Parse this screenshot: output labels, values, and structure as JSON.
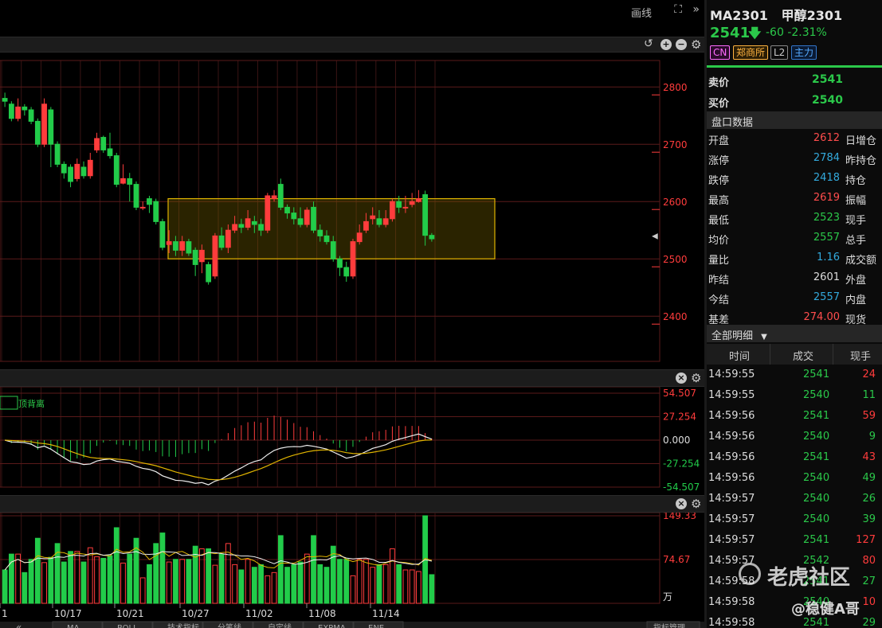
{
  "toolbar": {
    "draw_label": "画线"
  },
  "instrument": {
    "code": "MA2301",
    "name": "甲醇2301",
    "price": "2541",
    "change": "-60",
    "change_pct": "-2.31%",
    "tags": [
      "CN",
      "郑商所",
      "L2",
      "主力"
    ]
  },
  "quote": {
    "ask_label": "卖价",
    "ask": "2541",
    "bid_label": "买价",
    "bid": "2540",
    "section_label": "盘口数据",
    "rows": [
      {
        "k": "开盘",
        "v": "2612",
        "k2": "日增仓",
        "color": "#ff4d4d"
      },
      {
        "k": "涨停",
        "v": "2784",
        "k2": "昨持仓",
        "color": "#33aadd"
      },
      {
        "k": "跌停",
        "v": "2418",
        "k2": "持仓",
        "color": "#33aadd"
      },
      {
        "k": "最高",
        "v": "2619",
        "k2": "振幅",
        "color": "#ff4d4d"
      },
      {
        "k": "最低",
        "v": "2523",
        "k2": "现手",
        "color": "#2bc84a"
      },
      {
        "k": "均价",
        "v": "2557",
        "k2": "总手",
        "color": "#2bc84a"
      },
      {
        "k": "量比",
        "v": "1.16",
        "k2": "成交额",
        "color": "#33aadd"
      },
      {
        "k": "昨结",
        "v": "2601",
        "k2": "外盘",
        "color": "#dddddd"
      },
      {
        "k": "今结",
        "v": "2557",
        "k2": "内盘",
        "color": "#33aadd"
      },
      {
        "k": "基差",
        "v": "274.00",
        "k2": "现货",
        "color": "#ff4d4d"
      }
    ]
  },
  "trades": {
    "section_label": "全部明细",
    "headers": [
      "时间",
      "成交",
      "现手"
    ],
    "rows": [
      {
        "time": "14:59:55",
        "price": "2541",
        "qty": "24",
        "up": true
      },
      {
        "time": "14:59:55",
        "price": "2540",
        "qty": "11",
        "up": false
      },
      {
        "time": "14:59:56",
        "price": "2541",
        "qty": "59",
        "up": true
      },
      {
        "time": "14:59:56",
        "price": "2540",
        "qty": "9",
        "up": false
      },
      {
        "time": "14:59:56",
        "price": "2541",
        "qty": "43",
        "up": true
      },
      {
        "time": "14:59:56",
        "price": "2540",
        "qty": "49",
        "up": false
      },
      {
        "time": "14:59:57",
        "price": "2540",
        "qty": "26",
        "up": false
      },
      {
        "time": "14:59:57",
        "price": "2540",
        "qty": "39",
        "up": false
      },
      {
        "time": "14:59:57",
        "price": "2541",
        "qty": "127",
        "up": true
      },
      {
        "time": "14:59:57",
        "price": "2542",
        "qty": "80",
        "up": true
      },
      {
        "time": "14:59:58",
        "price": "2541",
        "qty": "27",
        "up": false
      },
      {
        "time": "14:59:58",
        "price": "2540",
        "qty": "10",
        "up": true
      },
      {
        "time": "14:59:58",
        "price": "2541",
        "qty": "29",
        "up": false
      }
    ]
  },
  "watermark": {
    "brand": "老虎社区",
    "author": "@稳健A哥"
  },
  "chart_data": [
    {
      "type": "candlestick",
      "y_ticks": [
        "2800",
        "2700",
        "2600",
        "2500",
        "2400"
      ],
      "ylim": [
        2310,
        2860
      ],
      "x_labels": [
        "1",
        "10/17",
        "10/21",
        "10/27",
        "11/02",
        "11/08",
        "11/14"
      ],
      "box": {
        "from_index": 21,
        "to_index": 61,
        "low": 2500,
        "high": 2605
      },
      "candles": [
        [
          2780,
          2775,
          2790,
          2765
        ],
        [
          2770,
          2745,
          2775,
          2740
        ],
        [
          2745,
          2765,
          2780,
          2740
        ],
        [
          2765,
          2760,
          2770,
          2750
        ],
        [
          2760,
          2740,
          2765,
          2735
        ],
        [
          2740,
          2700,
          2745,
          2695
        ],
        [
          2700,
          2770,
          2780,
          2695
        ],
        [
          2760,
          2700,
          2765,
          2660
        ],
        [
          2700,
          2665,
          2705,
          2660
        ],
        [
          2665,
          2650,
          2670,
          2640
        ],
        [
          2660,
          2635,
          2665,
          2625
        ],
        [
          2640,
          2665,
          2675,
          2635
        ],
        [
          2660,
          2645,
          2670,
          2640
        ],
        [
          2645,
          2672,
          2685,
          2640
        ],
        [
          2690,
          2710,
          2720,
          2685
        ],
        [
          2712,
          2690,
          2715,
          2685
        ],
        [
          2692,
          2680,
          2720,
          2675
        ],
        [
          2680,
          2630,
          2685,
          2625
        ],
        [
          2632,
          2640,
          2665,
          2630
        ],
        [
          2640,
          2630,
          2650,
          2600
        ],
        [
          2630,
          2590,
          2635,
          2585
        ],
        [
          2590,
          2590,
          2600,
          2585
        ],
        [
          2605,
          2595,
          2610,
          2580
        ],
        [
          2600,
          2565,
          2605,
          2560
        ],
        [
          2565,
          2520,
          2570,
          2515
        ],
        [
          2525,
          2530,
          2550,
          2510
        ],
        [
          2530,
          2515,
          2540,
          2505
        ],
        [
          2515,
          2530,
          2540,
          2505
        ],
        [
          2530,
          2510,
          2535,
          2505
        ],
        [
          2515,
          2490,
          2520,
          2470
        ],
        [
          2495,
          2515,
          2525,
          2475
        ],
        [
          2490,
          2460,
          2495,
          2455
        ],
        [
          2470,
          2540,
          2545,
          2465
        ],
        [
          2540,
          2520,
          2555,
          2515
        ],
        [
          2520,
          2550,
          2560,
          2510
        ],
        [
          2550,
          2560,
          2575,
          2545
        ],
        [
          2560,
          2555,
          2570,
          2545
        ],
        [
          2555,
          2570,
          2585,
          2550
        ],
        [
          2565,
          2560,
          2575,
          2545
        ],
        [
          2560,
          2550,
          2570,
          2540
        ],
        [
          2550,
          2610,
          2615,
          2545
        ],
        [
          2605,
          2610,
          2620,
          2600
        ],
        [
          2630,
          2590,
          2640,
          2585
        ],
        [
          2590,
          2580,
          2595,
          2570
        ],
        [
          2580,
          2570,
          2590,
          2560
        ],
        [
          2570,
          2560,
          2590,
          2555
        ],
        [
          2560,
          2585,
          2590,
          2555
        ],
        [
          2590,
          2550,
          2600,
          2545
        ],
        [
          2550,
          2540,
          2560,
          2530
        ],
        [
          2540,
          2530,
          2550,
          2525
        ],
        [
          2530,
          2500,
          2540,
          2495
        ],
        [
          2500,
          2485,
          2505,
          2470
        ],
        [
          2485,
          2470,
          2495,
          2460
        ],
        [
          2470,
          2530,
          2535,
          2465
        ],
        [
          2530,
          2545,
          2560,
          2525
        ],
        [
          2550,
          2565,
          2580,
          2545
        ],
        [
          2570,
          2575,
          2590,
          2560
        ],
        [
          2570,
          2560,
          2585,
          2555
        ],
        [
          2560,
          2570,
          2585,
          2555
        ],
        [
          2570,
          2600,
          2605,
          2565
        ],
        [
          2600,
          2590,
          2610,
          2580
        ],
        [
          2590,
          2590,
          2610,
          2580
        ],
        [
          2595,
          2600,
          2615,
          2590
        ],
        [
          2600,
          2605,
          2620,
          2598
        ],
        [
          2612,
          2541,
          2619,
          2523
        ],
        [
          2541,
          2535,
          2545,
          2530
        ]
      ]
    },
    {
      "type": "bar",
      "name": "MACD",
      "legend": "顶背离",
      "y_ticks": [
        "54.507",
        "27.254",
        "0.000",
        "-27.254",
        "-54.507"
      ],
      "ylim": [
        -54.507,
        54.507
      ]
    },
    {
      "type": "bar",
      "name": "Volume",
      "y_ticks": [
        "149.33",
        "74.67"
      ],
      "unit": "万",
      "ylim": [
        0,
        149.33
      ]
    }
  ],
  "bottom_tabs": [
    "MA",
    "BOLL",
    "技术指标",
    "分笔线",
    "自定线",
    "EXPMA",
    "ENE"
  ],
  "index_manage": "指标管理"
}
